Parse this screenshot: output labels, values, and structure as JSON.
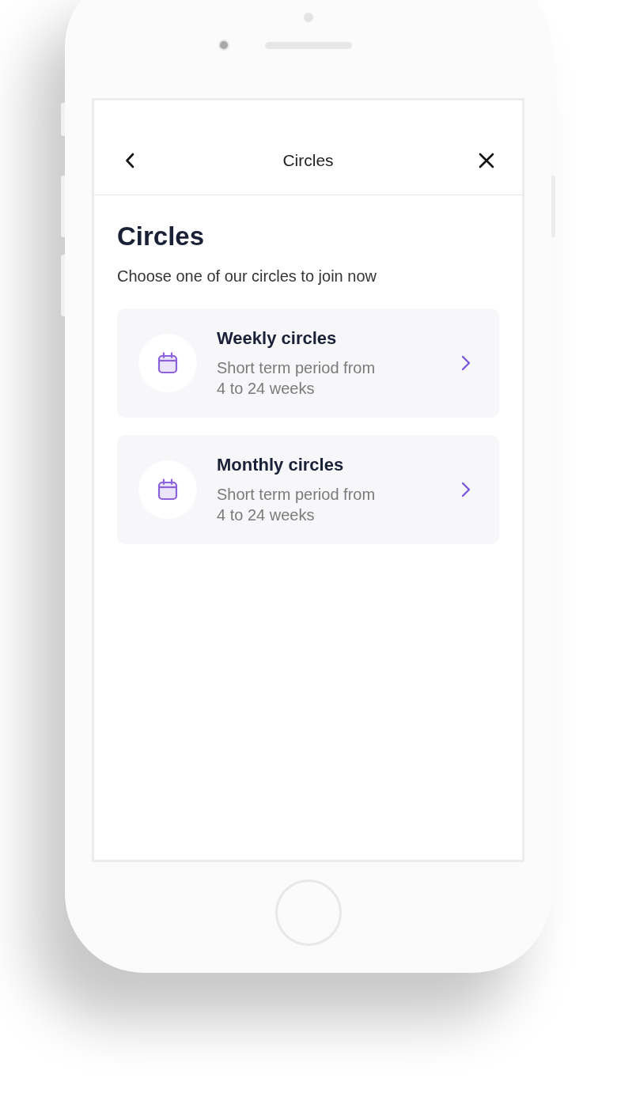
{
  "header": {
    "title": "Circles"
  },
  "page": {
    "heading": "Circles",
    "subtitle": "Choose one of our circles to join now"
  },
  "circles": [
    {
      "title": "Weekly circles",
      "description": "Short term period from 4 to 24 weeks"
    },
    {
      "title": "Monthly circles",
      "description": "Short term period from 4 to 24 weeks"
    }
  ]
}
